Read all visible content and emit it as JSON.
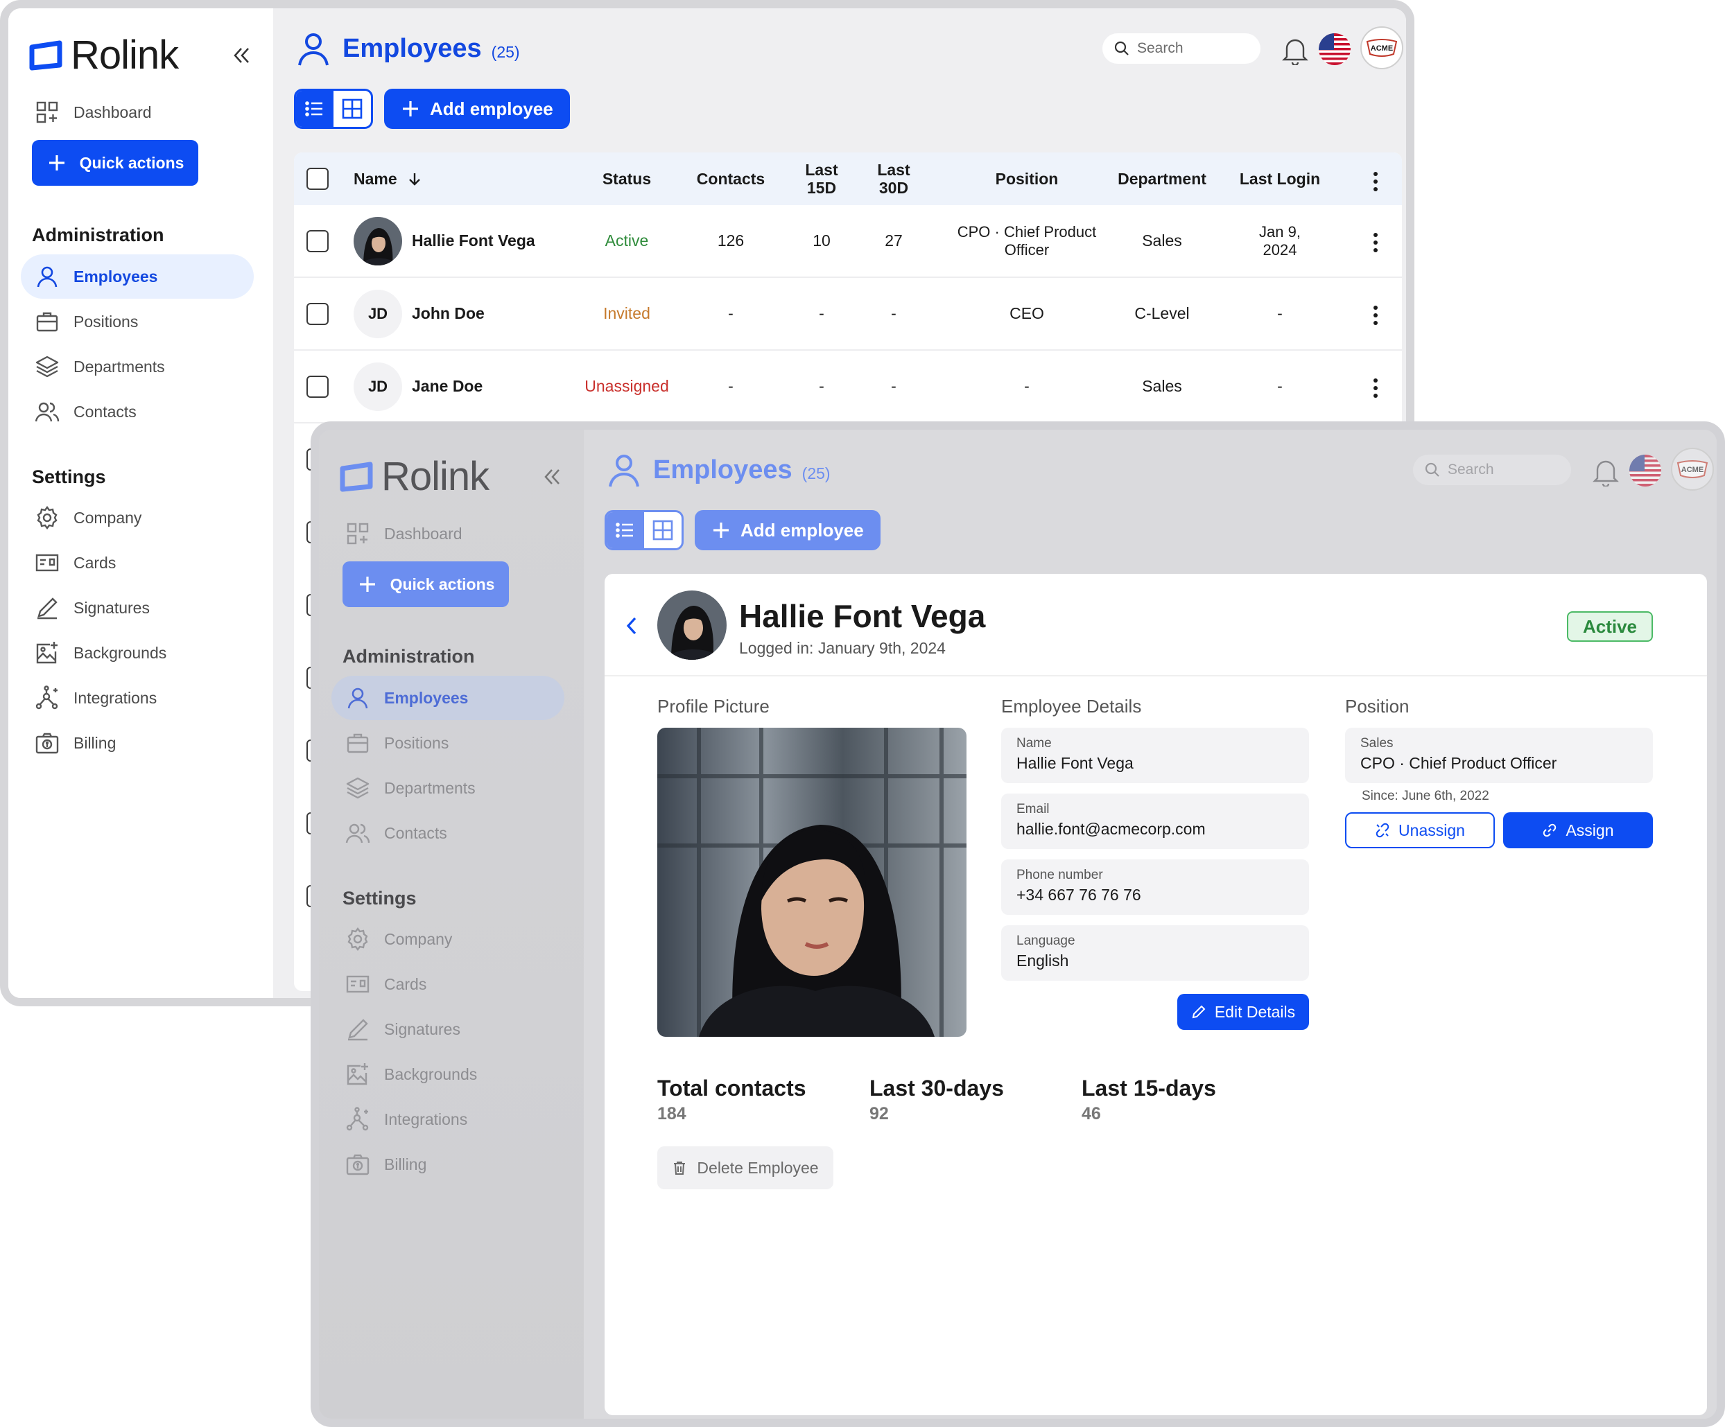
{
  "brand": {
    "name": "Rolink",
    "accent": "#0d4cf2"
  },
  "sidebar": {
    "dashboard": "Dashboard",
    "quick_actions": "Quick actions",
    "admin_heading": "Administration",
    "admin_items": [
      "Employees",
      "Positions",
      "Departments",
      "Contacts"
    ],
    "settings_heading": "Settings",
    "settings_items": [
      "Company",
      "Cards",
      "Signatures",
      "Backgrounds",
      "Integrations",
      "Billing"
    ]
  },
  "header": {
    "title": "Employees",
    "count": "(25)",
    "search_placeholder": "Search",
    "org_logo_text": "ACME"
  },
  "toolbar": {
    "add_label": "Add employee"
  },
  "table": {
    "columns": [
      "Name",
      "Status",
      "Contacts",
      "Last 15D",
      "Last 30D",
      "Position",
      "Department",
      "Last Login"
    ],
    "rows": [
      {
        "name": "Hallie Font Vega",
        "initials": "",
        "status": "Active",
        "contacts": "126",
        "last15": "10",
        "last30": "27",
        "position": "CPO · Chief Product Officer",
        "department": "Sales",
        "last_login": "Jan 9, 2024"
      },
      {
        "name": "John Doe",
        "initials": "JD",
        "status": "Invited",
        "contacts": "-",
        "last15": "-",
        "last30": "-",
        "position": "CEO",
        "department": "C-Level",
        "last_login": "-"
      },
      {
        "name": "Jane Doe",
        "initials": "JD",
        "status": "Unassigned",
        "contacts": "-",
        "last15": "-",
        "last30": "-",
        "position": "-",
        "department": "Sales",
        "last_login": "-"
      }
    ]
  },
  "detail": {
    "name": "Hallie Font Vega",
    "logged_in": "Logged in: January 9th, 2024",
    "status": "Active",
    "sections": {
      "picture": "Profile Picture",
      "details": "Employee Details",
      "position": "Position"
    },
    "fields": [
      {
        "label": "Name",
        "value": "Hallie Font Vega"
      },
      {
        "label": "Email",
        "value": "hallie.font@acmecorp.com"
      },
      {
        "label": "Phone number",
        "value": "+34 667 76 76 76"
      },
      {
        "label": "Language",
        "value": "English"
      }
    ],
    "edit_label": "Edit Details",
    "position": {
      "department": "Sales",
      "title": "CPO · Chief Product Officer",
      "since": "Since: June 6th, 2022"
    },
    "unassign_label": "Unassign",
    "assign_label": "Assign",
    "stats": [
      {
        "label": "Total contacts",
        "value": "184"
      },
      {
        "label": "Last 30-days",
        "value": "92"
      },
      {
        "label": "Last 15-days",
        "value": "46"
      }
    ],
    "delete_label": "Delete Employee"
  }
}
